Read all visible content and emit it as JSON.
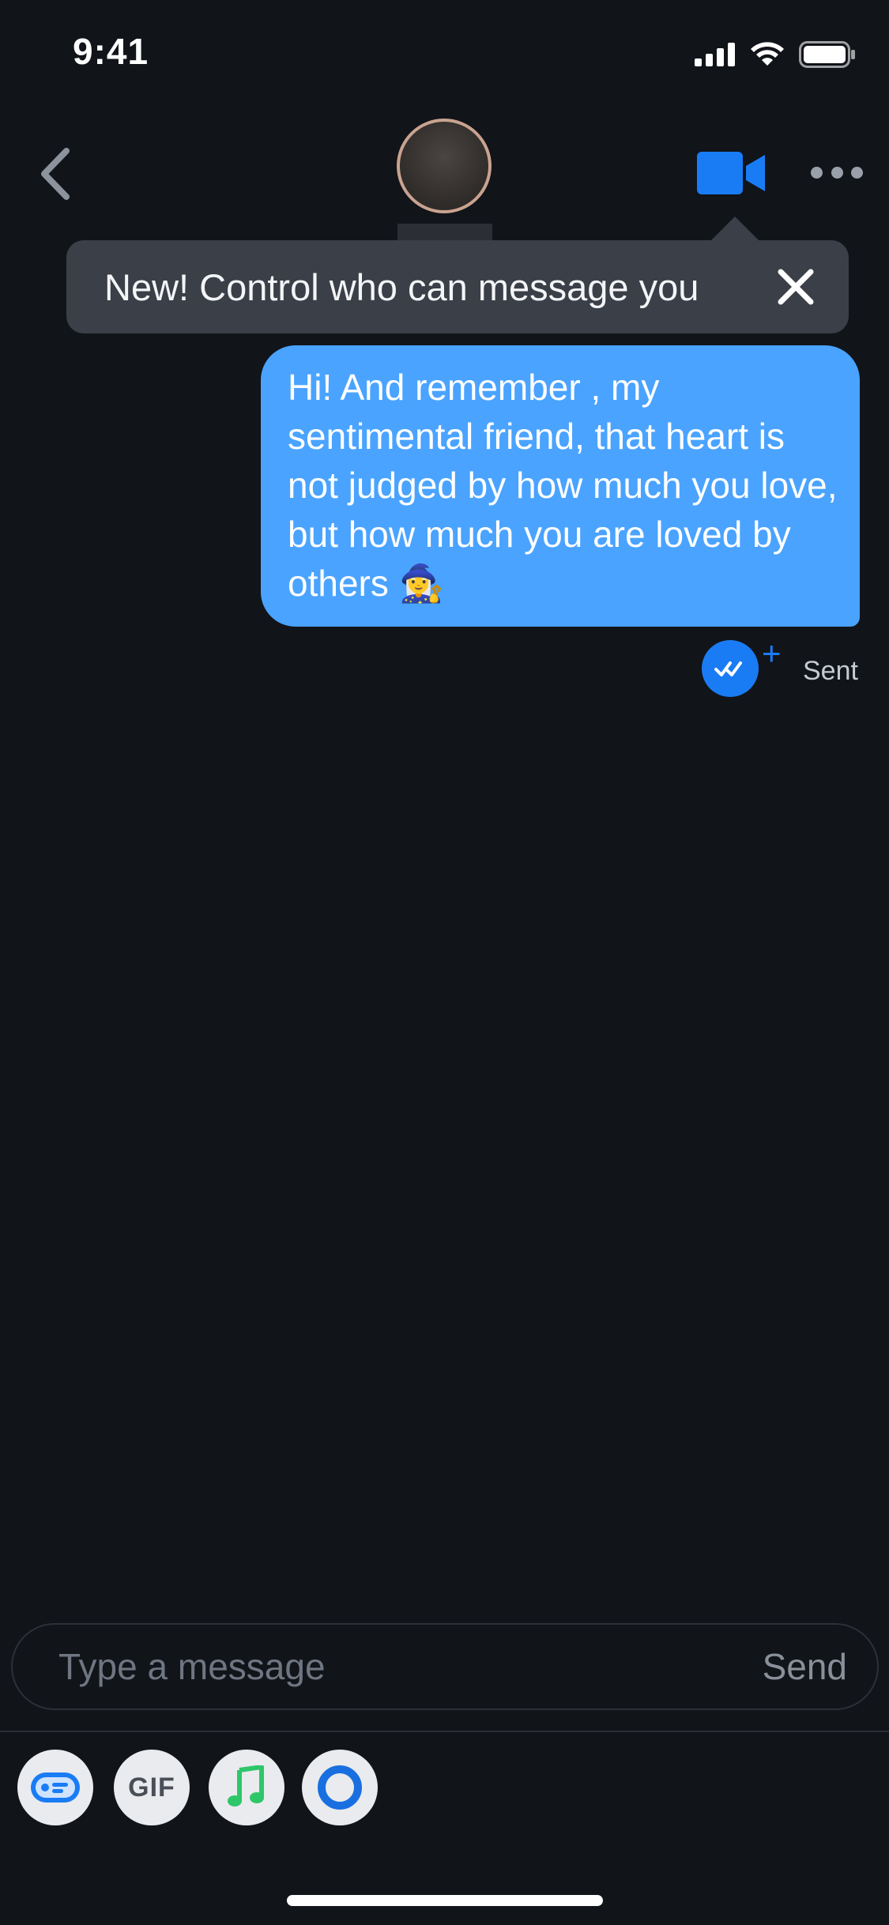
{
  "status_bar": {
    "time": "9:41"
  },
  "header": {
    "back_icon": "chevron-left-icon",
    "video_icon": "video-camera-icon",
    "more_icon": "ellipsis-icon"
  },
  "tooltip": {
    "text": "New! Control who can message you",
    "close_icon": "close-icon"
  },
  "message": {
    "text": "Hi! And remember , my sentimental friend, that heart is not judged by how much you love, but how much you are loved by others 🧙‍♀️",
    "status": "Sent"
  },
  "composer": {
    "placeholder": "Type a message",
    "send_label": "Send"
  },
  "toolbar": {
    "gif_label": "GIF",
    "items": [
      "sticker-icon",
      "gif-icon",
      "music-note-icon",
      "loop-icon"
    ]
  },
  "colors": {
    "background": "#111419",
    "bubble": "#4aa3ff",
    "accent": "#1a7cf5",
    "tooltip": "#3a3f48"
  }
}
